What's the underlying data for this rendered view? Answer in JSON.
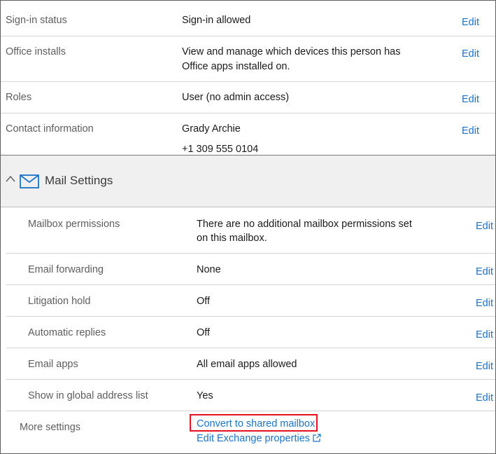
{
  "user_rows": [
    {
      "label": "Sign-in status",
      "value_lines": [
        "Sign-in allowed"
      ],
      "edit": "Edit"
    },
    {
      "label": "Office installs",
      "value_lines": [
        "View and manage which devices this person has",
        "Office apps installed on."
      ],
      "edit": "Edit"
    },
    {
      "label": "Roles",
      "value_lines": [
        "User (no admin access)"
      ],
      "edit": "Edit"
    },
    {
      "label": "Contact information",
      "value_lines": [
        "Grady Archie",
        "+1 309 555 0104"
      ],
      "edit": "Edit"
    }
  ],
  "mail_section": {
    "title": "Mail Settings",
    "icon": "envelope-icon",
    "rows": [
      {
        "label": "Mailbox permissions",
        "value_lines": [
          "There are no additional mailbox permissions set",
          "on this mailbox."
        ],
        "edit": "Edit"
      },
      {
        "label": "Email forwarding",
        "value_lines": [
          "None"
        ],
        "edit": "Edit"
      },
      {
        "label": "Litigation hold",
        "value_lines": [
          "Off"
        ],
        "edit": "Edit"
      },
      {
        "label": "Automatic replies",
        "value_lines": [
          "Off"
        ],
        "edit": "Edit"
      },
      {
        "label": "Email apps",
        "value_lines": [
          "All email apps allowed"
        ],
        "edit": "Edit"
      },
      {
        "label": "Show in global address list",
        "value_lines": [
          "Yes"
        ],
        "edit": "Edit"
      }
    ],
    "more_settings": {
      "label": "More settings",
      "convert_link": "Convert to shared mailbox",
      "exchange_link": "Edit Exchange properties"
    }
  },
  "colors": {
    "link": "#1c73c7",
    "highlight": "#e81123",
    "section_bg": "#f0f0f0"
  }
}
